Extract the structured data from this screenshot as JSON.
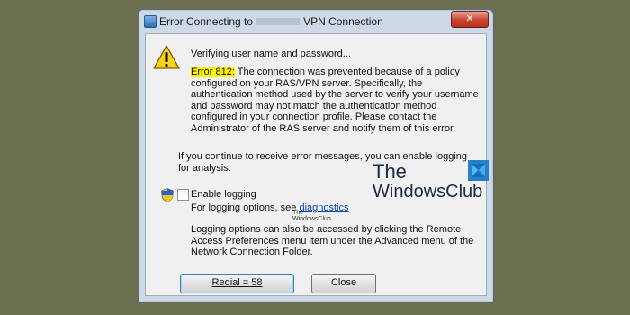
{
  "dialog": {
    "title_prefix": "Error Connecting to",
    "title_suffix": "VPN Connection",
    "close_glyph": "✕",
    "verify_text": "Verifying user name and password...",
    "error_code": "Error 812:",
    "error_message": "The connection was prevented because of a policy configured on your RAS/VPN server. Specifically, the authentication method used by the server to verify your username and password may not match the authentication method configured in your connection profile. Please contact the Administrator of the RAS server and notify them of this error.",
    "continue_text": "If you continue to receive error messages, you can enable logging for analysis.",
    "enable_logging_label": "Enable logging",
    "enable_logging_checked": false,
    "logging_options_text": "For logging options, see",
    "diagnostics_link": "diagnostics",
    "access_text": "Logging options can also be accessed by clicking the Remote Access Preferences menu item under the Advanced menu of the Network Connection Folder.",
    "redial_label": "Redial = 58",
    "close_label": "Close",
    "icons": [
      "warning-icon",
      "shield-icon",
      "window-icon",
      "close-icon"
    ]
  },
  "watermark": {
    "small_line1": "The",
    "small_line2": "WindowsClub",
    "the": "The",
    "name": "WindowsClub",
    "logo_colors": [
      "#2b7ec9",
      "#3fb0e8",
      "#4bc0ef",
      "#1a6bb8"
    ]
  }
}
